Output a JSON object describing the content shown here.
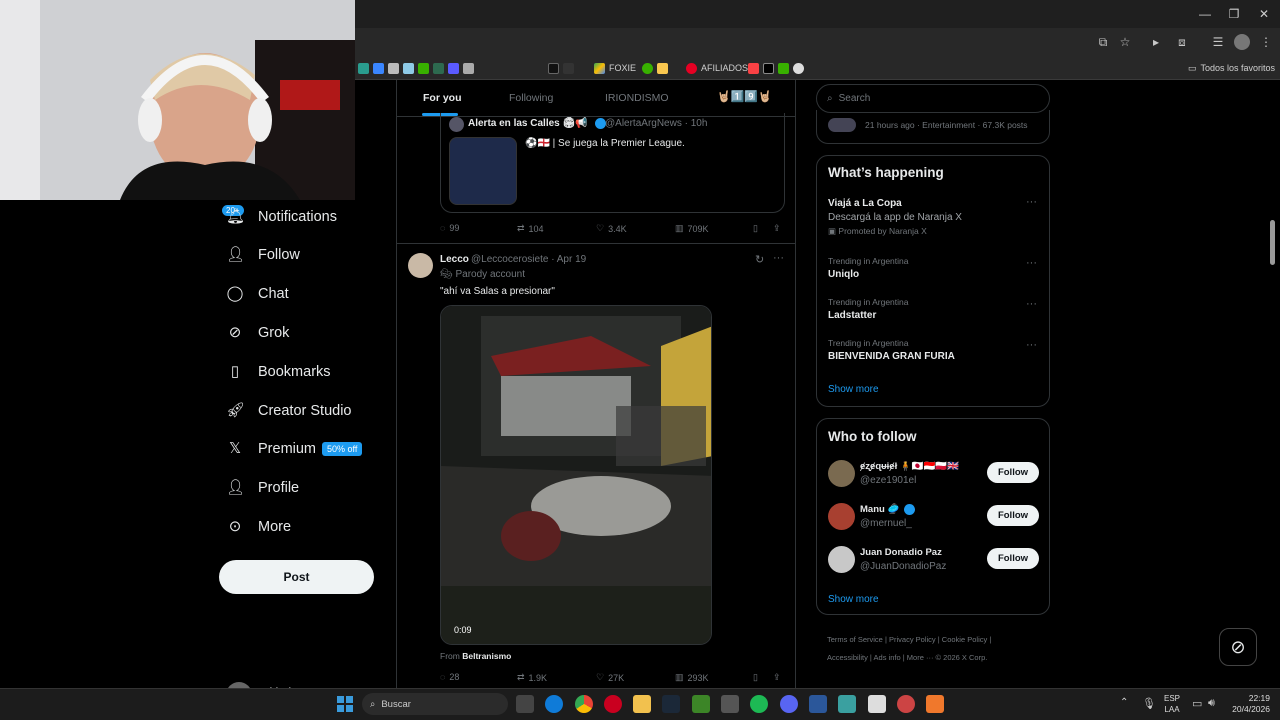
{
  "browser": {
    "bookmarks": [
      {
        "label": ""
      },
      {
        "label": ""
      },
      {
        "label": ""
      },
      {
        "label": ""
      },
      {
        "label": "FOXIE"
      },
      {
        "label": "AFILIADOS"
      }
    ],
    "favorites_label": "Todos los favoritos"
  },
  "nav": {
    "notifications": "Notifications",
    "notifications_badge": "20+",
    "follow": "Follow",
    "chat": "Chat",
    "grok": "Grok",
    "bookmarks": "Bookmarks",
    "creator_studio": "Creator Studio",
    "premium": "Premium",
    "premium_badge": "50% off",
    "profile": "Profile",
    "more": "More",
    "post": "Post",
    "account_name": "tobigrippo"
  },
  "feed": {
    "tabs": [
      "For you",
      "Following",
      "IRIONDISMO",
      "🤘🏼1️⃣9️⃣🤘🏼"
    ],
    "quoted": {
      "name": "Alerta en las Calles 🏟📢",
      "handle": "@AlertaArgNews · 10h",
      "text": "⚽🏴󠁧󠁢󠁥󠁮󠁧󠁿 | Se juega la Premier League."
    },
    "tweet1_metrics": {
      "replies": "99",
      "retweets": "104",
      "likes": "3.4K",
      "views": "709K"
    },
    "tweet2": {
      "name": "Lecco",
      "handle": "@Leccocerosiete · Apr 19",
      "parody": "Parody account",
      "text": "\"ahí va Salas a presionar\"",
      "video_time": "0:09",
      "from_label": "From",
      "from_source": "Beltranismo",
      "metrics": {
        "replies": "28",
        "retweets": "1.9K",
        "likes": "27K",
        "views": "293K"
      }
    }
  },
  "right": {
    "search_placeholder": "Search",
    "top_meta": "21 hours ago · Entertainment · 67.3K posts",
    "whats_happening": "What’s happening",
    "promo": {
      "title": "Viajá a La Copa",
      "sub": "Descargá la app de Naranja X",
      "promoted": "Promoted by Naranja X"
    },
    "trends": [
      {
        "context": "Trending in Argentina",
        "name": "Uniqlo"
      },
      {
        "context": "Trending in Argentina",
        "name": "Ladstatter"
      },
      {
        "context": "Trending in Argentina",
        "name": "BIENVENIDA GRAN FURIA"
      }
    ],
    "show_more": "Show more",
    "who_to_follow": "Who to follow",
    "follow_suggestions": [
      {
        "name": "ɇʐɇɋᵾɨɇł 🧍🇯🇵🇮🇩🇵🇱🇬🇧",
        "handle": "@eze1901el",
        "button": "Follow"
      },
      {
        "name": "Manu 🥏",
        "handle": "@mernuel_",
        "button": "Follow"
      },
      {
        "name": "Juan Donadio Paz",
        "handle": "@JuanDonadioPaz",
        "button": "Follow"
      }
    ],
    "show_more_2": "Show more",
    "footer": [
      "Terms of Service",
      "Privacy Policy",
      "Cookie Policy",
      "Accessibility",
      "Ads info",
      "More ···",
      "© 2026 X Corp."
    ]
  },
  "taskbar": {
    "search": "Buscar",
    "lang1": "ESP",
    "lang2": "LAA",
    "time": "22:19",
    "date": "20/4/2026"
  }
}
